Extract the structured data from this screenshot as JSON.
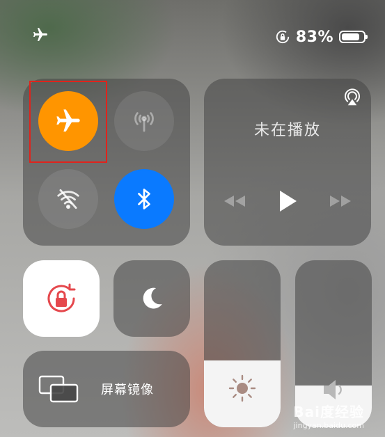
{
  "status_bar": {
    "battery_percent": "83%",
    "battery_level": 0.83,
    "icons": [
      "airplane-mode-icon",
      "orientation-lock-icon",
      "battery-icon"
    ]
  },
  "connectivity": {
    "airplane_mode": {
      "on": true,
      "color": "#ff9500",
      "icon": "airplane-icon"
    },
    "cellular_data": {
      "on": false,
      "icon": "cellular-antenna-icon"
    },
    "wifi": {
      "on": false,
      "icon": "wifi-off-icon"
    },
    "bluetooth": {
      "on": true,
      "color": "#0a7aff",
      "icon": "bluetooth-icon"
    }
  },
  "media": {
    "status": "未在播放",
    "icons": [
      "airplay-audio-icon",
      "rewind-icon",
      "play-icon",
      "fast-forward-icon"
    ]
  },
  "orientation_lock": {
    "on": true,
    "color": "#e5484d",
    "icon": "rotation-lock-icon"
  },
  "do_not_disturb": {
    "on": false,
    "icon": "moon-icon"
  },
  "screen_mirroring": {
    "label": "屏幕镜像",
    "icon": "screen-mirroring-icon"
  },
  "brightness": {
    "level": 0.4,
    "icon": "sun-icon"
  },
  "volume": {
    "level": 0.25,
    "icon": "speaker-icon"
  },
  "watermark": {
    "text_big": "Bai度经验",
    "text_small": "jingyan.baidu.com"
  }
}
